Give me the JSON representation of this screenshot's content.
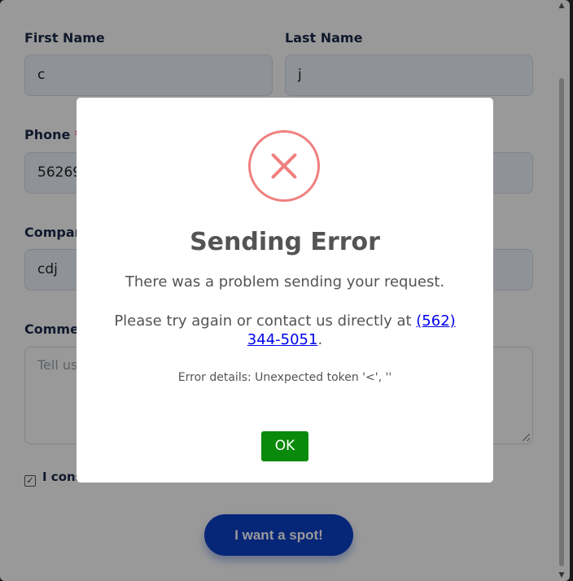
{
  "form": {
    "first_name": {
      "label": "First Name",
      "value": "c"
    },
    "last_name": {
      "label": "Last Name",
      "value": "j"
    },
    "phone": {
      "label": "Phone",
      "required_mark": "*",
      "value": "56269"
    },
    "company": {
      "label": "Compar",
      "value": "cdj"
    },
    "comments": {
      "label": "Comme",
      "placeholder": "Tell us"
    },
    "consent": {
      "checked": true,
      "text": "I cons"
    },
    "submit_label": "I want a spot!"
  },
  "modal": {
    "title": "Sending Error",
    "message": "There was a problem sending your request.",
    "contact_prefix": "Please try again or contact us directly at ",
    "contact_phone": "(562) 344-5051",
    "contact_suffix": ".",
    "error_details": "Error details: Unexpected token '<', ''",
    "ok_label": "OK"
  },
  "colors": {
    "error_icon": "#f08080",
    "ok_button": "#0a8a0a",
    "submit_button": "#0a40c8",
    "link": "#0000ee"
  },
  "icons": {
    "error": "x-circle-icon",
    "checkbox": "check-icon",
    "scroll_up": "chevron-up-icon",
    "scroll_down": "chevron-down-icon"
  }
}
